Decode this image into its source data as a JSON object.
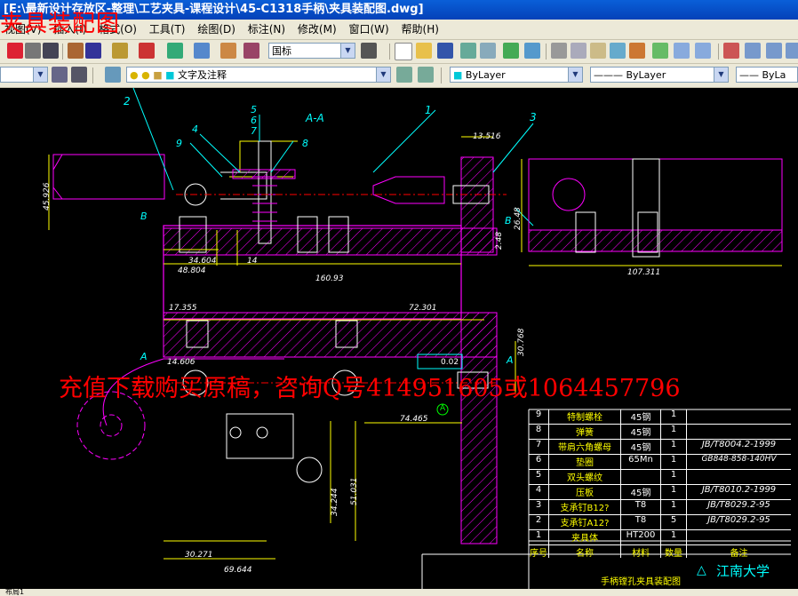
{
  "window": {
    "title": "[E:\\最新设计存放区-整理\\工艺夹具-课程设计\\45-C1318手柄\\夹具装配图.dwg]"
  },
  "menu": {
    "items": [
      "视图(V)",
      "插入(I)",
      "格式(O)",
      "工具(T)",
      "绘图(D)",
      "标注(N)",
      "修改(M)",
      "窗口(W)",
      "帮助(H)"
    ]
  },
  "toolbar": {
    "text_style": "国标",
    "layer": "文字及注释",
    "color": "ByLayer",
    "linetype": "ByLayer",
    "lineweight": "ByLa"
  },
  "watermark": {
    "top": "夹具装配图",
    "mid": "充值下载购买原稿，咨询Q号414951605或1064457796"
  },
  "drawing": {
    "section_label": "A-A",
    "part_numbers": [
      "1",
      "2",
      "3",
      "4",
      "5",
      "6",
      "7",
      "8",
      "9"
    ],
    "dims": {
      "d1": "45.926",
      "d2": "13.516",
      "d3": "34.604",
      "d4": "48.804",
      "d5": "14",
      "d6": "160.93",
      "d7": "26.48",
      "d8": "2.48",
      "d9": "107.311",
      "d10": "17.355",
      "d11": "72.301",
      "d12": "14.606",
      "d13": "30.768",
      "d14": "74.465",
      "d15": "34.244",
      "d16": "51.031",
      "d17": "30.271",
      "d18": "69.644",
      "tol": "0.02",
      "datum": "A",
      "marker_b": "B",
      "marker_a": "A"
    }
  },
  "bom": {
    "rows": [
      {
        "no": "9",
        "name": "特制螺栓",
        "mat": "45钢",
        "qty": "1",
        "std": ""
      },
      {
        "no": "8",
        "name": "弹簧",
        "mat": "45钢",
        "qty": "1",
        "std": ""
      },
      {
        "no": "7",
        "name": "带肩六角螺母",
        "mat": "45钢",
        "qty": "1",
        "std": "JB/T8004.2-1999"
      },
      {
        "no": "6",
        "name": "垫圈",
        "mat": "65Mn",
        "qty": "1",
        "std": "GB848-858-140HV"
      },
      {
        "no": "5",
        "name": "双头螺纹",
        "mat": "",
        "qty": "1",
        "std": ""
      },
      {
        "no": "4",
        "name": "压板",
        "mat": "45钢",
        "qty": "1",
        "std": "JB/T8010.2-1999"
      },
      {
        "no": "3",
        "name": "支承钉B12?",
        "mat": "T8",
        "qty": "1",
        "std": "JB/T8029.2-95"
      },
      {
        "no": "2",
        "name": "支承钉A12?",
        "mat": "T8",
        "qty": "5",
        "std": "JB/T8029.2-95"
      },
      {
        "no": "1",
        "name": "夹具体",
        "mat": "HT200",
        "qty": "1",
        "std": ""
      }
    ],
    "header": {
      "no": "序号",
      "name": "名称",
      "mat": "材料",
      "qty": "数量",
      "std": "备注"
    },
    "title": "手柄镗孔夹具装配图",
    "school": "江南大学"
  },
  "status": {
    "tab": "布局1"
  }
}
